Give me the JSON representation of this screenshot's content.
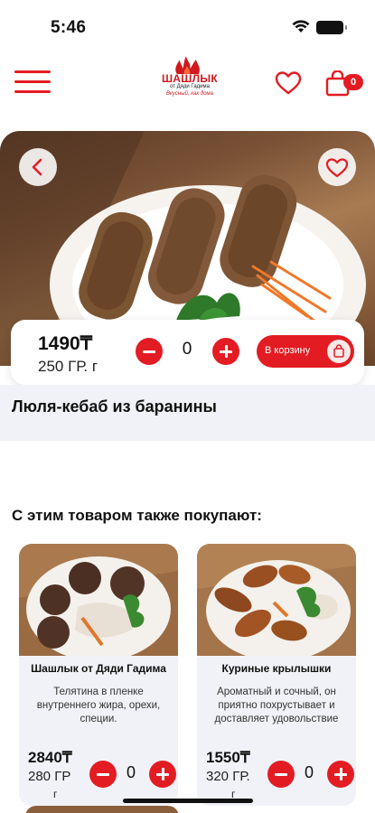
{
  "status_bar": {
    "time": "5:46"
  },
  "header": {
    "logo_title": "ШАШЛЫК",
    "logo_subtitle": "от Дяди Гадима",
    "logo_tagline": "Вкусный, как дома",
    "cart_count": "0"
  },
  "product": {
    "price": "1490₸",
    "weight": "250 ГР. г",
    "quantity": "0",
    "cart_button_label": "В корзину",
    "title": "Люля-кебаб из баранины"
  },
  "recommendations": {
    "section_title": "С этим товаром также покупают:",
    "items": [
      {
        "name": "Шашлык от Дяди Гадима",
        "description": "Телятина в пленке внутреннего жира, орехи, специи.",
        "price": "2840₸",
        "weight": "280 ГР",
        "unit": "г",
        "quantity": "0"
      },
      {
        "name": "Куриные крылышки",
        "description": "Ароматный и сочный, он приятно похрустывает и доставляет удовольствие",
        "price": "1550₸",
        "weight": "320 ГР.",
        "unit": "г",
        "quantity": "0"
      }
    ]
  },
  "colors": {
    "accent": "#e31c23",
    "band": "#f1f2f7"
  },
  "icons": {
    "menu": "menu-icon",
    "favorite": "heart-icon",
    "cart": "shopping-bag-icon",
    "back": "chevron-left-icon"
  }
}
